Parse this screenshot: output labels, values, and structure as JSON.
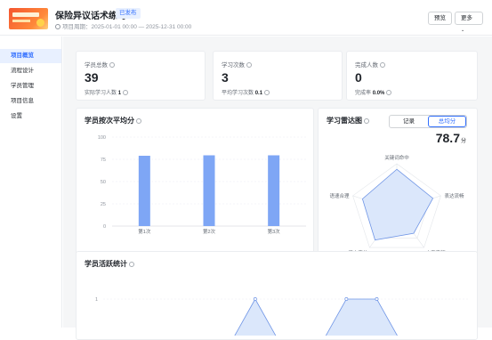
{
  "header": {
    "title": "保险异议话术练习",
    "status_badge": "已发布",
    "period": "项目周期：2025-01-01 00:00 — 2025-12-31 00:00",
    "preview_label": "预览",
    "more_label": "更多"
  },
  "sidebar": {
    "items": [
      {
        "label": "项目概览",
        "active": true
      },
      {
        "label": "流程设计",
        "active": false
      },
      {
        "label": "学员管理",
        "active": false
      },
      {
        "label": "项目信息",
        "active": false
      },
      {
        "label": "设置",
        "active": false
      }
    ]
  },
  "stats": [
    {
      "label": "学员总数",
      "value": "39",
      "sub_label": "实际学习人数",
      "sub_value": "1"
    },
    {
      "label": "学习次数",
      "value": "3",
      "sub_label": "平均学习次数",
      "sub_value": "0.1"
    },
    {
      "label": "完成人数",
      "value": "0",
      "sub_label": "完成率",
      "sub_value": "0.0%"
    }
  ],
  "avg_score_card": {
    "title": "学员按次平均分"
  },
  "radar_card": {
    "title": "学习雷达图",
    "tab_record": "记录",
    "tab_avg": "总均分",
    "score": "78.7",
    "score_unit": "分"
  },
  "activity_card": {
    "title": "学员活跃统计"
  },
  "colors": {
    "accent": "#3370ff",
    "bar": "#7ea6f5",
    "radar_fill": "#dbe7fb",
    "radar_stroke": "#6f95e6"
  },
  "chart_data": [
    {
      "type": "bar",
      "categories": [
        "第1次",
        "第2次",
        "第3次"
      ],
      "values": [
        79,
        79.5,
        79.5
      ],
      "ylim": [
        0,
        100
      ],
      "yticks": [
        0,
        25,
        50,
        75,
        100
      ],
      "grid": true
    },
    {
      "type": "radar",
      "axes": [
        "关键词命中",
        "表达流畅",
        "内容完整",
        "语言完美",
        "语速合理"
      ],
      "values": [
        88,
        82,
        62,
        80,
        78
      ],
      "max": 100
    },
    {
      "type": "area",
      "ytick": "1",
      "points": [
        0,
        0,
        0,
        0,
        0,
        1,
        0,
        0,
        1,
        1,
        0,
        0,
        0
      ],
      "grid": true
    }
  ]
}
